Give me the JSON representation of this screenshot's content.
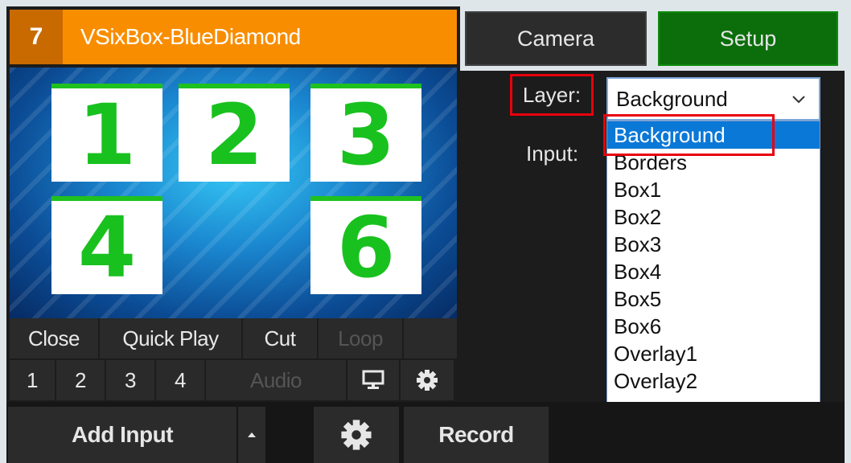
{
  "input": {
    "number": "7",
    "name": "VSixBox-BlueDiamond",
    "boxes": [
      {
        "label": "1"
      },
      {
        "label": "2"
      },
      {
        "label": "3"
      },
      {
        "label": "4"
      },
      {
        "label": "6"
      }
    ],
    "controls": {
      "close": "Close",
      "quick_play": "Quick Play",
      "cut": "Cut",
      "loop": "Loop",
      "btn1": "1",
      "btn2": "2",
      "btn3": "3",
      "btn4": "4",
      "audio": "Audio",
      "monitor_icon": "monitor-icon",
      "settings_icon": "gear-icon"
    }
  },
  "tabs": {
    "camera": "Camera",
    "setup": "Setup"
  },
  "form": {
    "layer_label": "Layer:",
    "input_label": "Input:",
    "layer_select_value": "Background",
    "layer_options": [
      "Background",
      "Borders",
      "Box1",
      "Box2",
      "Box3",
      "Box4",
      "Box5",
      "Box6",
      "Overlay1",
      "Overlay2"
    ]
  },
  "bottom": {
    "add_input": "Add Input",
    "record": "Record",
    "settings_icon": "gear-icon"
  },
  "colors": {
    "title_bar": "#f98d00",
    "setup_tab": "#0b6e0b",
    "selected_option": "#0a78d7",
    "highlight": "#e8000c",
    "box_digits": "#19c11f"
  }
}
